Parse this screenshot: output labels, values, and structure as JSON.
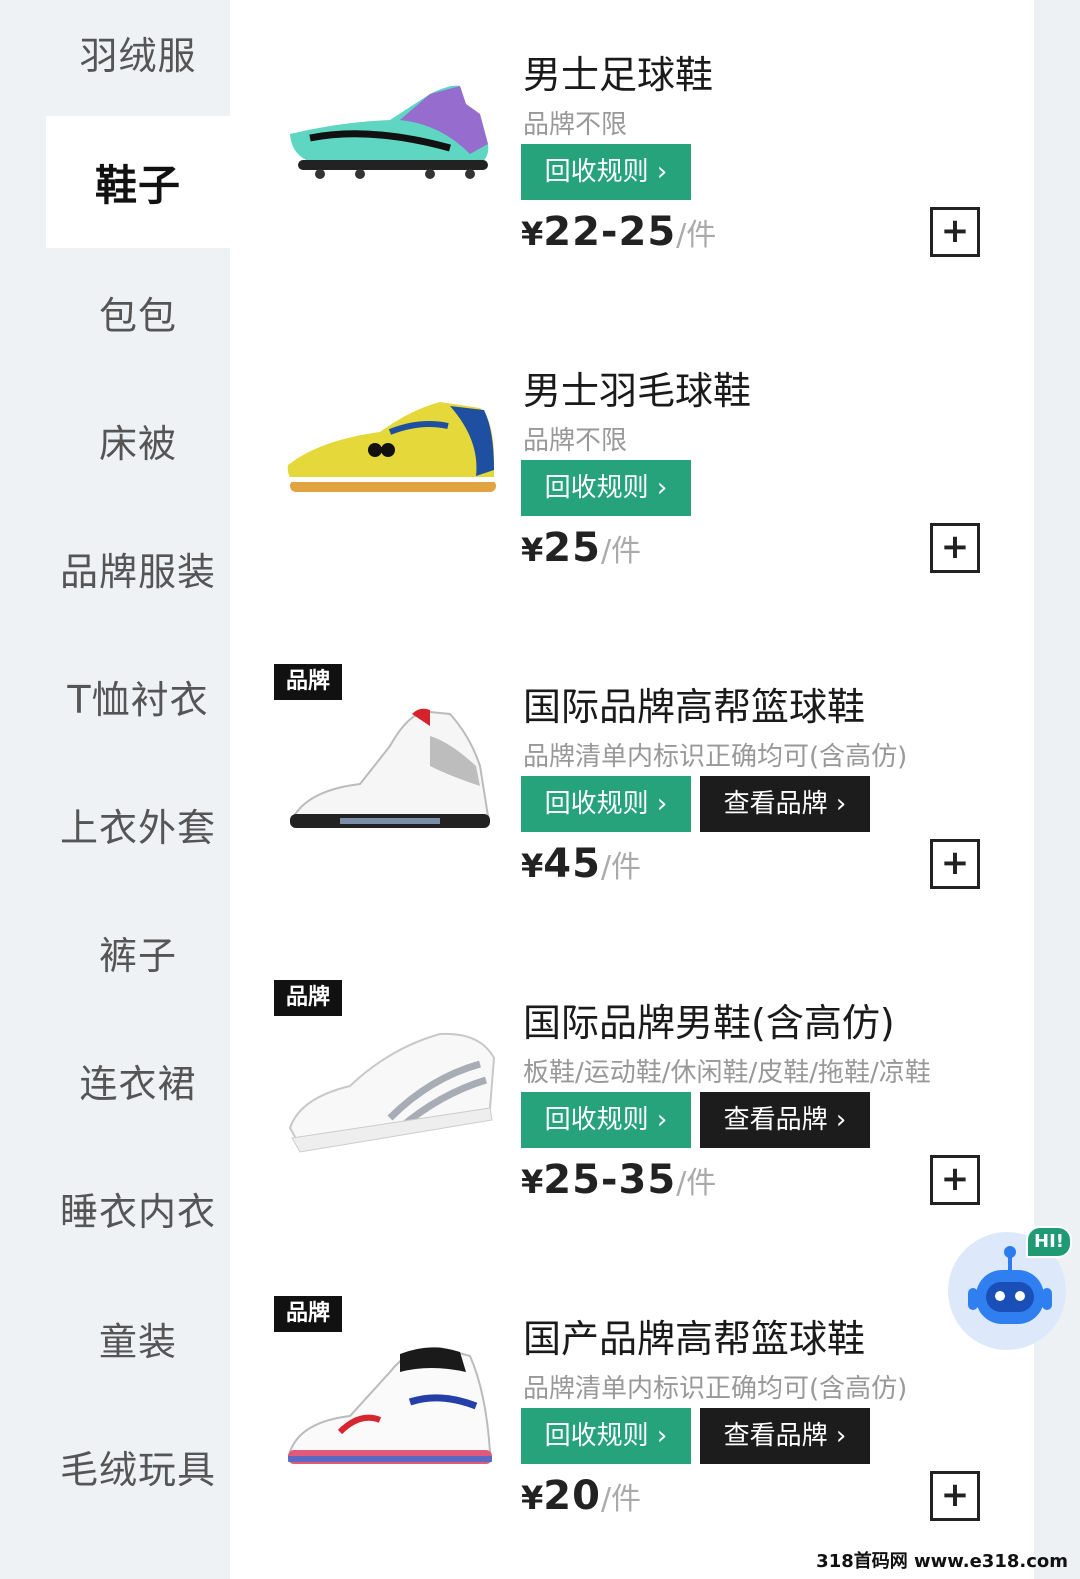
{
  "sidebar": {
    "items": [
      {
        "label": "羽绒服"
      },
      {
        "label": "鞋子"
      },
      {
        "label": "包包"
      },
      {
        "label": "床被"
      },
      {
        "label": "品牌服装"
      },
      {
        "label": "T恤衬衣"
      },
      {
        "label": "上衣外套"
      },
      {
        "label": "裤子"
      },
      {
        "label": "连衣裙"
      },
      {
        "label": "睡衣内衣"
      },
      {
        "label": "童装"
      },
      {
        "label": "毛绒玩具"
      }
    ],
    "active_label": "鞋子"
  },
  "products": [
    {
      "name": "男士足球鞋",
      "subtitle": "品牌不限",
      "rule_label": "回收规则 ›",
      "price_currency": "¥",
      "price": "22-25",
      "unit": "/件",
      "icon": "soccer-cleat"
    },
    {
      "name": "男士羽毛球鞋",
      "subtitle": "品牌不限",
      "rule_label": "回收规则 ›",
      "price_currency": "¥",
      "price": "25",
      "unit": "/件",
      "icon": "badminton-shoe"
    },
    {
      "name": "国际品牌高帮篮球鞋",
      "tag": "品牌",
      "subtitle": "品牌清单内标识正确均可(含高仿)",
      "rule_label": "回收规则 ›",
      "brand_label": "查看品牌 ›",
      "price_currency": "¥",
      "price": "45",
      "unit": "/件",
      "icon": "high-top-sneaker"
    },
    {
      "name": "国际品牌男鞋(含高仿)",
      "tag": "品牌",
      "subtitle": "板鞋/运动鞋/休闲鞋/皮鞋/拖鞋/凉鞋",
      "rule_label": "回收规则 ›",
      "brand_label": "查看品牌 ›",
      "price_currency": "¥",
      "price": "25-35",
      "unit": "/件",
      "icon": "low-top-sneaker"
    },
    {
      "name": "国产品牌高帮篮球鞋",
      "tag": "品牌",
      "subtitle": "品牌清单内标识正确均可(含高仿)",
      "rule_label": "回收规则 ›",
      "brand_label": "查看品牌 ›",
      "price_currency": "¥",
      "price": "20",
      "unit": "/件",
      "icon": "high-top-sneaker"
    }
  ],
  "assistant": {
    "badge": "HI!",
    "icon": "robot-icon"
  },
  "watermark": "318首码网 www.e318.com",
  "colors": {
    "accent_green": "#26a37a",
    "dark_button": "#1c1c1c",
    "sidebar_bg": "#eff2f5"
  }
}
